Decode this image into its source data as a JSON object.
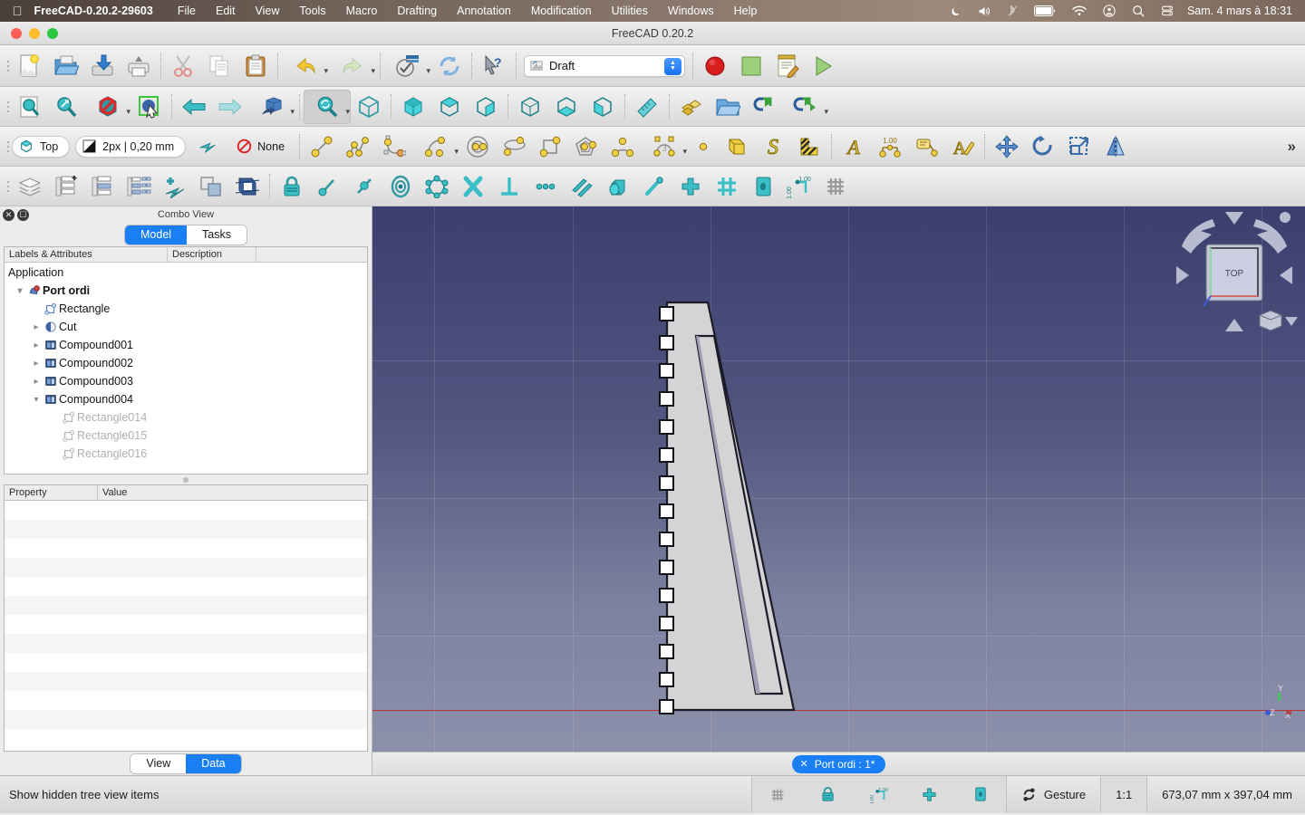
{
  "menubar": {
    "apple_icon": "apple-logo-icon",
    "app_name": "FreeCAD-0.20.2-29603",
    "items": [
      "File",
      "Edit",
      "View",
      "Tools",
      "Macro",
      "Drafting",
      "Annotation",
      "Modification",
      "Utilities",
      "Windows",
      "Help"
    ],
    "status_icons": [
      "moon-icon",
      "volume-icon",
      "bluetooth-off-icon",
      "battery-icon",
      "wifi-icon",
      "control-center-icon",
      "search-icon",
      "notification-icon"
    ],
    "clock": "Sam. 4 mars à  18:31"
  },
  "window": {
    "title": "FreeCAD 0.20.2",
    "traffic_lights": [
      "close-button",
      "minimize-button",
      "zoom-button"
    ]
  },
  "toolbar_file": {
    "items": [
      "new-document-icon",
      "open-document-icon",
      "save-document-icon",
      "print-icon",
      "cut-icon",
      "copy-icon",
      "paste-icon",
      "undo-icon",
      "redo-icon",
      "refresh-icon",
      "std-refresh-icon",
      "whats-this-icon"
    ]
  },
  "workbench": {
    "icon": "draft-workbench-icon",
    "value": "Draft",
    "placeholder": "Draft"
  },
  "toolbar_macro": {
    "items": [
      "macro-record-icon",
      "macro-stop-icon",
      "macro-edit-icon",
      "macro-execute-icon"
    ]
  },
  "toolbar_view": {
    "items": [
      "fit-all-icon",
      "fit-selection-icon",
      "draw-style-icon",
      "box-selection-icon",
      "back-view-icon",
      "forward-view-icon",
      "isometric-view-icon",
      "sync-view-icon",
      "axonometric-icon",
      "front-view-icon",
      "top-view-icon",
      "right-view-icon",
      "rear-view-icon",
      "bottom-view-icon",
      "left-view-icon",
      "measure-icon",
      "appearance-icon",
      "part-folder-icon",
      "link-icon",
      "link-group-icon"
    ]
  },
  "toolbar_draft_snap": {
    "view_mode": {
      "icon": "top-view-icon",
      "label": "Top"
    },
    "line_style": {
      "icon": "linestyle-icon",
      "label": "2px | 0,20 mm"
    },
    "autogroup": {
      "icon": "autogroup-icon",
      "label": ""
    },
    "working_plane": {
      "icon": "none-icon",
      "label": "None"
    },
    "tools": [
      "line-icon",
      "polyline-icon",
      "fillet-icon",
      "arc-icon",
      "circle-icon",
      "ellipse-icon",
      "rectangle-icon",
      "polygon-icon",
      "bspline-icon",
      "bezier-icon",
      "point-icon",
      "facebinder-icon",
      "shapestring-icon",
      "hatch-icon",
      "text-icon",
      "dimension-icon",
      "label-icon",
      "annotation-style-icon",
      "move-icon",
      "rotate-icon",
      "scale-icon",
      "mirror-icon"
    ],
    "overflow": "»"
  },
  "toolbar_modification": {
    "items": [
      "layer-icon",
      "add-to-group-icon",
      "group-icon",
      "select-group-icon",
      "add-point-icon",
      "wire-to-bspline-icon",
      "shape-2d-view-icon",
      "snap-lock-icon",
      "snap-endpoint-icon",
      "snap-midpoint-icon",
      "snap-center-icon",
      "snap-angle-icon",
      "snap-intersection-icon",
      "snap-perpendicular-icon",
      "snap-extension-icon",
      "snap-parallel-icon",
      "snap-special-icon",
      "snap-near-icon",
      "snap-ortho-icon",
      "snap-grid-icon",
      "snap-working-plane-icon",
      "snap-dimensions-icon",
      "toggle-grid-icon"
    ]
  },
  "combo_view": {
    "title": "Combo View",
    "close_icon": "close-panel-icon",
    "float_icon": "float-panel-icon",
    "tabs": [
      {
        "label": "Model",
        "active": true
      },
      {
        "label": "Tasks",
        "active": false
      }
    ],
    "tree_headers": [
      "Labels & Attributes",
      "Description",
      ""
    ],
    "tree": [
      {
        "label": "Application",
        "depth": 0,
        "arrow": "",
        "icon": "",
        "bold": false,
        "dim": false
      },
      {
        "label": "Port ordi",
        "depth": 1,
        "arrow": "v",
        "icon": "document-icon",
        "bold": true,
        "dim": false
      },
      {
        "label": "Rectangle",
        "depth": 2,
        "arrow": "",
        "icon": "rectangle-icon",
        "bold": false,
        "dim": false
      },
      {
        "label": "Cut",
        "depth": 2,
        "arrow": ">",
        "icon": "cut-shape-icon",
        "bold": false,
        "dim": false
      },
      {
        "label": "Compound001",
        "depth": 2,
        "arrow": ">",
        "icon": "compound-icon",
        "bold": false,
        "dim": false
      },
      {
        "label": "Compound002",
        "depth": 2,
        "arrow": ">",
        "icon": "compound-icon",
        "bold": false,
        "dim": false
      },
      {
        "label": "Compound003",
        "depth": 2,
        "arrow": ">",
        "icon": "compound-icon",
        "bold": false,
        "dim": false
      },
      {
        "label": "Compound004",
        "depth": 2,
        "arrow": "v",
        "icon": "compound-icon",
        "bold": false,
        "dim": false
      },
      {
        "label": "Rectangle014",
        "depth": 3,
        "arrow": "",
        "icon": "rectangle-icon",
        "bold": false,
        "dim": true
      },
      {
        "label": "Rectangle015",
        "depth": 3,
        "arrow": "",
        "icon": "rectangle-icon",
        "bold": false,
        "dim": true
      },
      {
        "label": "Rectangle016",
        "depth": 3,
        "arrow": "",
        "icon": "rectangle-icon",
        "bold": false,
        "dim": true
      }
    ],
    "property_headers": [
      "Property",
      "Value"
    ],
    "property_rows": [],
    "property_row_count": 13,
    "bottom_tabs": [
      {
        "label": "View",
        "active": false
      },
      {
        "label": "Data",
        "active": true
      }
    ]
  },
  "view3d": {
    "document_tab": {
      "label": "Port ordi : 1*",
      "close_icon": "close-tab-icon"
    },
    "navigation_cube": {
      "face_label": "TOP",
      "arrows": [
        "rotate-left-arrow",
        "rotate-right-arrow",
        "up-arrow",
        "down-arrow",
        "left-arrow",
        "right-arrow"
      ],
      "corner_icon": "home-cube-icon"
    },
    "axis_indicator": {
      "x": "X",
      "y": "Y",
      "z": "Z"
    },
    "background_top": "#3b3f6e",
    "background_bottom": "#9093ad"
  },
  "statusbar": {
    "message": "Show hidden tree view items",
    "toggles": [
      "toggle-grid-icon",
      "snap-lock-icon",
      "snap-dimensions-icon",
      "add-icon",
      "snap-working-plane-icon"
    ],
    "navigation": {
      "icon": "gesture-navigation-icon",
      "label": "Gesture"
    },
    "zoom": "1:1",
    "dimensions": "673,07 mm x 397,04 mm"
  }
}
